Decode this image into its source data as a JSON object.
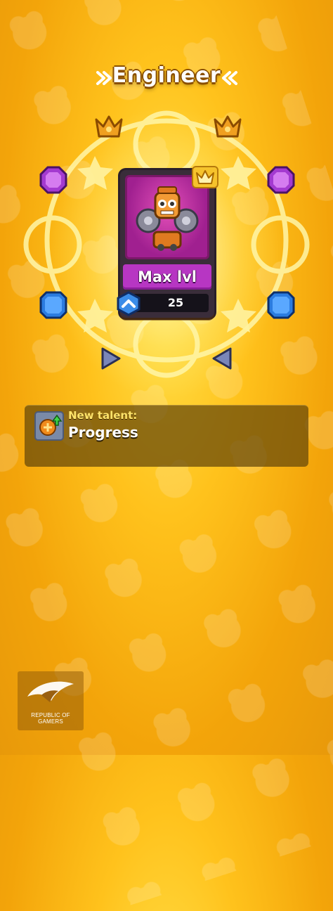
{
  "header": {
    "title": "Engineer"
  },
  "card": {
    "name": "Engineer",
    "status_label": "Max lvl",
    "level": "25"
  },
  "talent": {
    "caption": "New talent:",
    "name": "Progress"
  },
  "branding": {
    "text": "REPUBLIC OF GAMERS"
  },
  "colors": {
    "background": "#ffc21c",
    "card_frame": "#3a2d3a",
    "card_art": "#c23aa6",
    "max_label": "#b736c3",
    "talent_caption": "#ffe46a"
  },
  "icons": {
    "crowns": [
      "crown-icon",
      "crown-icon"
    ],
    "gems_purple": [
      "purple-gem-icon",
      "purple-gem-icon"
    ],
    "gems_blue": [
      "blue-gem-icon",
      "blue-gem-icon"
    ],
    "arrows": [
      "arrow-right-icon",
      "arrow-left-icon"
    ],
    "level_icon": "level-chevron-icon",
    "talent_icon": "talent-upgrade-icon",
    "brand_logo": "rog-eye-logo"
  }
}
